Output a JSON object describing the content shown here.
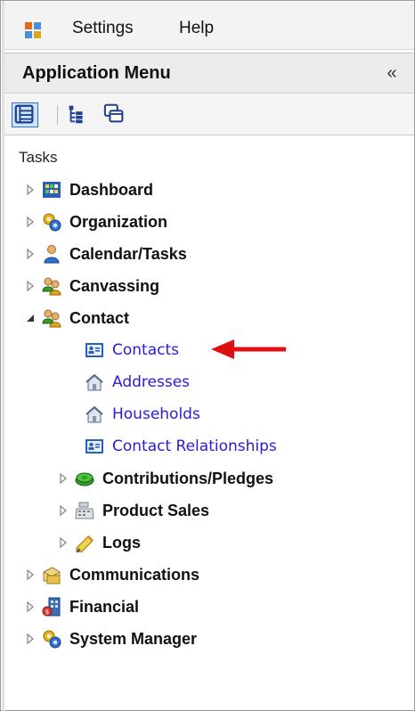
{
  "menubar": {
    "items": [
      {
        "label": "Settings"
      },
      {
        "label": "Help"
      }
    ]
  },
  "app_menu": {
    "title": "Application Menu",
    "collapse_glyph": "«"
  },
  "toolbar": {
    "buttons": [
      {
        "icon": "list-view-icon",
        "active": true
      },
      {
        "icon": "tree-view-icon",
        "active": false
      },
      {
        "icon": "windows-icon",
        "active": false
      }
    ]
  },
  "tasks": {
    "label": "Tasks",
    "tree": [
      {
        "label": "Dashboard",
        "icon": "dashboard-icon",
        "expanded": false
      },
      {
        "label": "Organization",
        "icon": "organization-icon",
        "expanded": false
      },
      {
        "label": "Calendar/Tasks",
        "icon": "calendar-tasks-icon",
        "expanded": false
      },
      {
        "label": "Canvassing",
        "icon": "canvassing-icon",
        "expanded": false
      },
      {
        "label": "Contact",
        "icon": "contact-group-icon",
        "expanded": true,
        "children": [
          {
            "label": "Contacts",
            "icon": "contact-card-icon",
            "type": "link"
          },
          {
            "label": "Addresses",
            "icon": "house-icon",
            "type": "link"
          },
          {
            "label": "Households",
            "icon": "house-icon",
            "type": "link"
          },
          {
            "label": "Contact Relationships",
            "icon": "contact-card-icon",
            "type": "link"
          },
          {
            "label": "Contributions/Pledges",
            "icon": "money-icon",
            "type": "folder"
          },
          {
            "label": "Product Sales",
            "icon": "cash-register-icon",
            "type": "folder"
          },
          {
            "label": "Logs",
            "icon": "pencil-icon",
            "type": "folder"
          }
        ]
      },
      {
        "label": "Communications",
        "icon": "communications-icon",
        "expanded": false
      },
      {
        "label": "Financial",
        "icon": "financial-icon",
        "expanded": false
      },
      {
        "label": "System Manager",
        "icon": "system-manager-icon",
        "expanded": false
      }
    ]
  },
  "annotation": {
    "color": "#e01010",
    "points_to": "Contacts"
  }
}
